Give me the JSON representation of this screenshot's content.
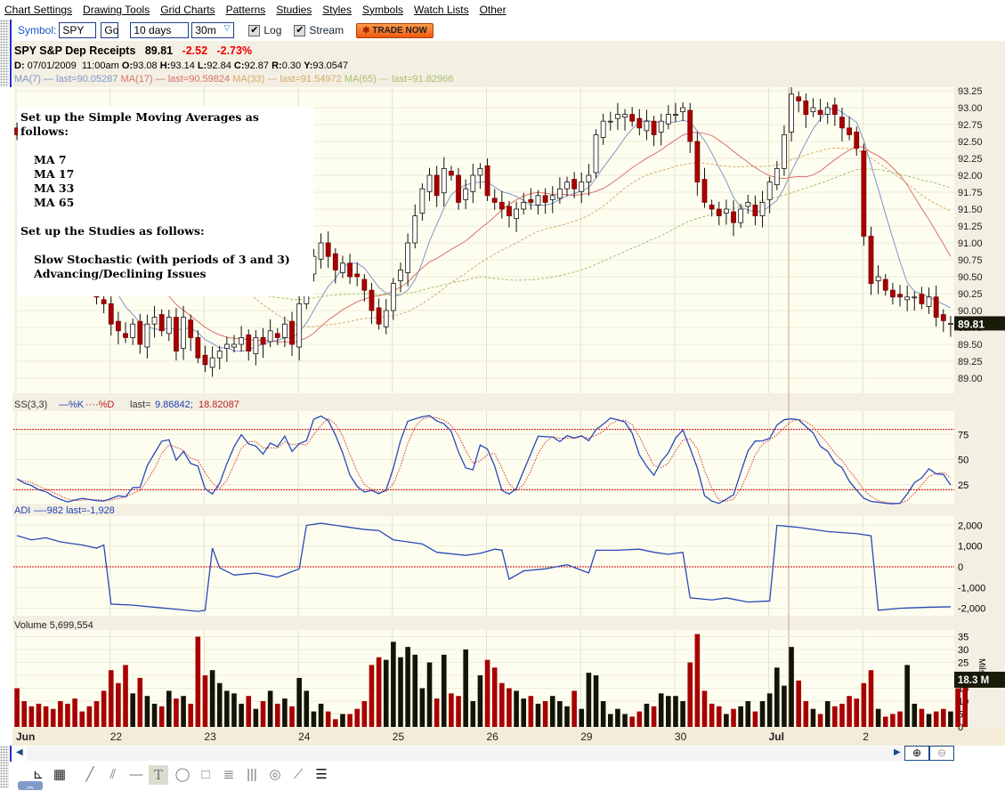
{
  "menu": [
    "Chart Settings",
    "Drawing Tools",
    "Grid Charts",
    "Patterns",
    "Studies",
    "Styles",
    "Symbols",
    "Watch Lists",
    "Other"
  ],
  "toolbar": {
    "symbol_label": "Symbol:",
    "symbol_value": "SPY",
    "go": "Go",
    "range": "10 days",
    "interval": "30m",
    "log_label": "Log",
    "log_checked": true,
    "stream_label": "Stream",
    "stream_checked": true,
    "trade": "TRADE NOW"
  },
  "quote": {
    "name": "SPY S&P Dep Receipts",
    "last": "89.81",
    "change": "-2.52",
    "pct": "-2.73%",
    "detail": [
      [
        "D:",
        " 07/01/2009  11:00am "
      ],
      [
        "O:",
        "93.08 "
      ],
      [
        "H:",
        "93.14 "
      ],
      [
        "L:",
        "92.84 "
      ],
      [
        "C:",
        "92.87 "
      ],
      [
        "R:",
        "0.30 "
      ],
      [
        "Y:",
        "93.0547"
      ]
    ],
    "ma": [
      {
        "label": "MA(7) — last=90.05287",
        "color": "#7f96c8",
        "period": 7
      },
      {
        "label": "MA(17) — last=90.59824",
        "color": "#d9706a",
        "period": 17
      },
      {
        "label": "MA(33) --- last=91.54972",
        "color": "#d7a96a",
        "period": 33
      },
      {
        "label": "MA(65) --- last=91.82966",
        "color": "#a8c070",
        "period": 65
      }
    ]
  },
  "overlay": {
    "lines": [
      "Set up the Simple Moving Averages as follows:",
      "",
      "MA 7",
      "MA 17",
      "MA 33",
      "MA 65",
      "",
      "Set up the Studies as follows:",
      "",
      "Slow Stochastic (with periods of 3 and 3)",
      "Advancing/Declining Issues"
    ]
  },
  "chart_data": {
    "type": "candlestick",
    "price_ticks": [
      "93.25",
      "93.00",
      "92.75",
      "92.50",
      "92.25",
      "92.00",
      "91.75",
      "91.50",
      "91.25",
      "91.00",
      "90.75",
      "90.50",
      "90.25",
      "90.00",
      "89.75",
      "89.50",
      "89.25",
      "89.00"
    ],
    "last_price": "89.81",
    "days": [
      "Jun",
      "22",
      "23",
      "24",
      "25",
      "26",
      "29",
      "30",
      "Jul",
      "2"
    ],
    "close": [
      92.6,
      92.4,
      92.2,
      92.0,
      91.8,
      91.5,
      91.3,
      91.0,
      90.8,
      90.6,
      90.4,
      90.2,
      90.1,
      89.8,
      89.7,
      89.6,
      89.8,
      89.5,
      89.8,
      89.9,
      89.7,
      89.9,
      89.4,
      89.9,
      89.6,
      89.3,
      89.2,
      89.3,
      89.4,
      89.5,
      89.5,
      89.6,
      89.4,
      89.6,
      89.5,
      89.7,
      89.6,
      89.8,
      89.5,
      90.1,
      90.5,
      90.8,
      91.0,
      90.8,
      90.6,
      90.7,
      90.5,
      90.5,
      90.3,
      90.0,
      89.8,
      90.0,
      90.4,
      90.6,
      91.0,
      91.4,
      91.8,
      92.0,
      91.7,
      92.1,
      92.0,
      91.6,
      91.8,
      92.0,
      92.1,
      91.7,
      91.6,
      91.5,
      91.4,
      91.5,
      91.6,
      91.6,
      91.7,
      91.6,
      91.7,
      91.8,
      91.9,
      91.8,
      91.9,
      92.0,
      92.6,
      92.8,
      92.8,
      92.9,
      92.9,
      92.8,
      92.7,
      92.8,
      92.6,
      92.8,
      92.9,
      92.9,
      93.0,
      92.5,
      91.9,
      91.6,
      91.5,
      91.4,
      91.5,
      91.3,
      91.5,
      91.6,
      91.4,
      91.6,
      91.9,
      92.1,
      92.6,
      93.2,
      93.1,
      92.9,
      93.0,
      92.9,
      93.0,
      92.9,
      92.7,
      92.6,
      92.4,
      91.1,
      90.4,
      90.5,
      90.3,
      90.2,
      90.2,
      90.2,
      90.2,
      90.1,
      90.2,
      89.9,
      89.85,
      89.81
    ],
    "volume": [
      15,
      10,
      8,
      9,
      8,
      7,
      10,
      9,
      11,
      6,
      8,
      10,
      14,
      22,
      17,
      24,
      13,
      19,
      12,
      9,
      8,
      14,
      11,
      12,
      9,
      35,
      20,
      22,
      17,
      14,
      13,
      9,
      12,
      7,
      10,
      14,
      9,
      11,
      8,
      19,
      14,
      6,
      9,
      6,
      3,
      5,
      5,
      7,
      10,
      24,
      27,
      26,
      33,
      27,
      31,
      28,
      15,
      25,
      11,
      28,
      13,
      12,
      30,
      10,
      20,
      26,
      23,
      17,
      15,
      14,
      11,
      12,
      9,
      10,
      12,
      10,
      8,
      14,
      7,
      21,
      20,
      10,
      5,
      7,
      5,
      4,
      6,
      9,
      8,
      13,
      12,
      12,
      10,
      25,
      36,
      14,
      9,
      8,
      5,
      7,
      8,
      10,
      6,
      10,
      13,
      23,
      16,
      31,
      18,
      10,
      7,
      5,
      10,
      8,
      9,
      12,
      11,
      17,
      22,
      7,
      4,
      5,
      6,
      24,
      9,
      7,
      5,
      6,
      7,
      6,
      15,
      18.3
    ],
    "volume_ticks": [
      "35",
      "30",
      "25",
      "20",
      "15",
      "10",
      "5",
      "0"
    ],
    "volume_unit": "Mils",
    "volume_last": "18.3 M",
    "stoch": {
      "label": "SS(3,3)",
      "k_label": "%K",
      "d_label": "%D",
      "last_label": "last=",
      "k_last": "9.86842",
      "d_last": "18.82087",
      "ticks": [
        "75",
        "50",
        "25"
      ],
      "upper": 80,
      "lower": 20
    },
    "adi": {
      "label": "ADI",
      "legend": "-982 last=-1,928",
      "ticks": [
        "2,000",
        "1,000",
        "0",
        "-1,000",
        "-2,000"
      ],
      "points": [
        [
          0,
          1500
        ],
        [
          2,
          1300
        ],
        [
          4,
          1400
        ],
        [
          6,
          1200
        ],
        [
          8,
          1100
        ],
        [
          9,
          1050
        ],
        [
          11,
          900
        ],
        [
          12,
          1050
        ],
        [
          13,
          -1800
        ],
        [
          16,
          -1850
        ],
        [
          19,
          -1950
        ],
        [
          22,
          -2050
        ],
        [
          25,
          -2150
        ],
        [
          26,
          -2100
        ],
        [
          27,
          900
        ],
        [
          28,
          -50
        ],
        [
          30,
          -400
        ],
        [
          33,
          -300
        ],
        [
          36,
          -500
        ],
        [
          39,
          -100
        ],
        [
          40,
          2000
        ],
        [
          42,
          2100
        ],
        [
          45,
          1950
        ],
        [
          48,
          1800
        ],
        [
          50,
          1750
        ],
        [
          52,
          1300
        ],
        [
          54,
          1200
        ],
        [
          56,
          1100
        ],
        [
          58,
          700
        ],
        [
          62,
          550
        ],
        [
          64,
          650
        ],
        [
          66,
          850
        ],
        [
          67,
          800
        ],
        [
          68,
          -600
        ],
        [
          70,
          -200
        ],
        [
          73,
          -100
        ],
        [
          76,
          100
        ],
        [
          79,
          -300
        ],
        [
          80,
          800
        ],
        [
          83,
          800
        ],
        [
          86,
          850
        ],
        [
          88,
          700
        ],
        [
          90,
          600
        ],
        [
          92,
          700
        ],
        [
          93,
          -1500
        ],
        [
          96,
          -1600
        ],
        [
          98,
          -1500
        ],
        [
          101,
          -1700
        ],
        [
          104,
          -1650
        ],
        [
          105,
          2000
        ],
        [
          108,
          1900
        ],
        [
          112,
          1700
        ],
        [
          116,
          1600
        ],
        [
          118,
          1500
        ],
        [
          119,
          -2100
        ],
        [
          122,
          -2000
        ],
        [
          126,
          -1950
        ],
        [
          129,
          -1928
        ]
      ]
    }
  }
}
